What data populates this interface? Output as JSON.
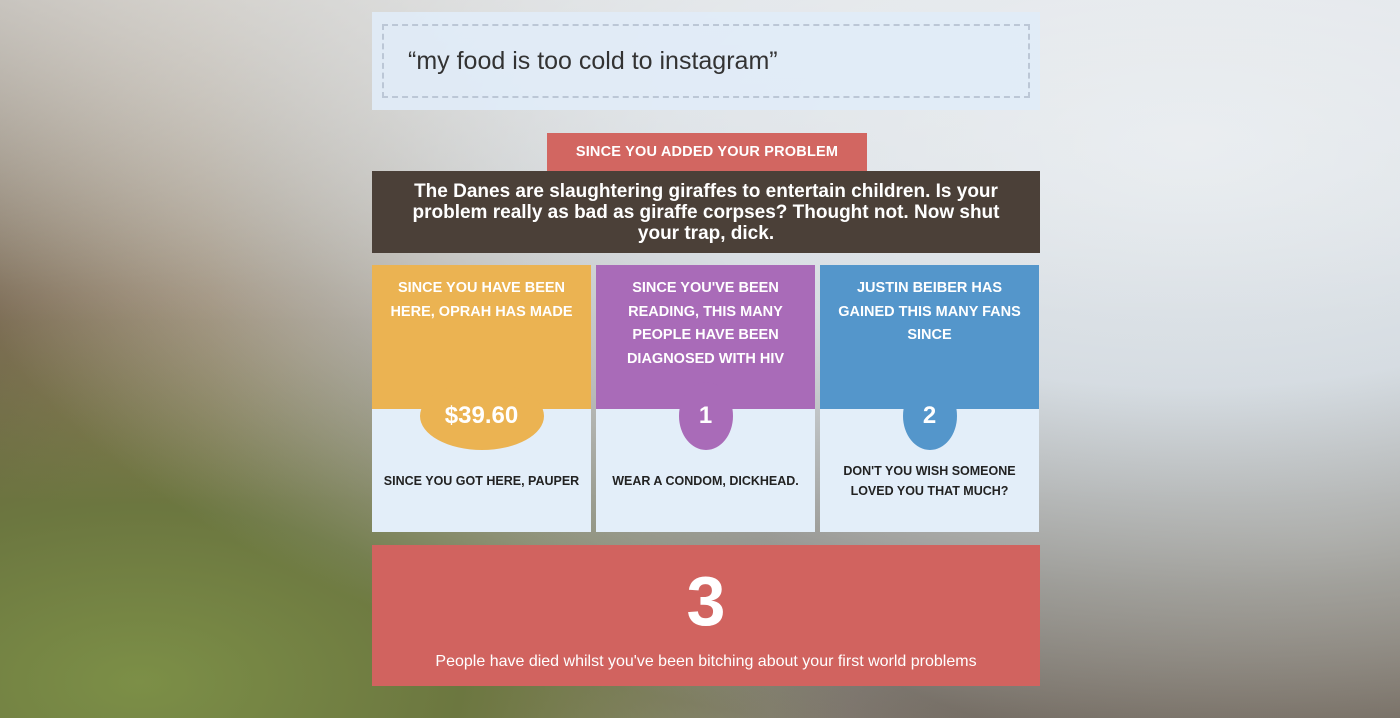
{
  "quote": {
    "text": "“my food is too cold to instagram”"
  },
  "tag": {
    "label": "SINCE YOU ADDED YOUR PROBLEM"
  },
  "headline": {
    "text": "The Danes are slaughtering giraffes to entertain children. Is your problem really as bad as giraffe corpses? Thought not. Now shut your trap, dick."
  },
  "cards": [
    {
      "title": "SINCE YOU HAVE BEEN HERE, OPRAH HAS MADE",
      "value": "$39.60",
      "caption": "SINCE YOU GOT HERE, PAUPER",
      "color": "#ebb352"
    },
    {
      "title": "SINCE YOU'VE BEEN READING, THIS MANY PEOPLE HAVE BEEN DIAGNOSED WITH HIV",
      "value": "1",
      "caption": "WEAR A CONDOM, DICKHEAD.",
      "color": "#a96bb8"
    },
    {
      "title": "JUSTIN BEIBER HAS GAINED THIS MANY FANS SINCE",
      "value": "2",
      "caption": "DON'T YOU WISH SOMEONE LOVED YOU THAT MUCH?",
      "color": "#5496cb"
    }
  ],
  "footer": {
    "number": "3",
    "text": "People have died whilst you've been bitching about your first world problems",
    "color": "#d1635f"
  }
}
